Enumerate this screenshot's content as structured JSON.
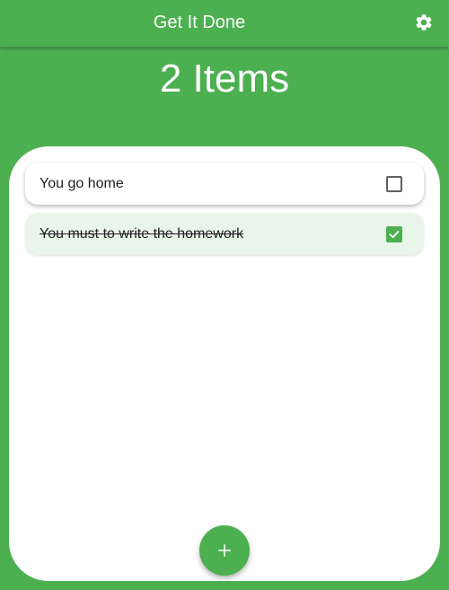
{
  "app": {
    "title": "Get It Done",
    "settings_icon": "gear-icon"
  },
  "summary": {
    "count_text": "2 Items"
  },
  "tasks": [
    {
      "label": "You go home",
      "checked": false
    },
    {
      "label": "You must to write the homework",
      "checked": true
    }
  ],
  "fab": {
    "icon": "plus-icon"
  },
  "colors": {
    "primary": "#4caf50",
    "done_row_background": "#e8f5e9",
    "card_background": "#ffffff",
    "text": "#222222"
  }
}
